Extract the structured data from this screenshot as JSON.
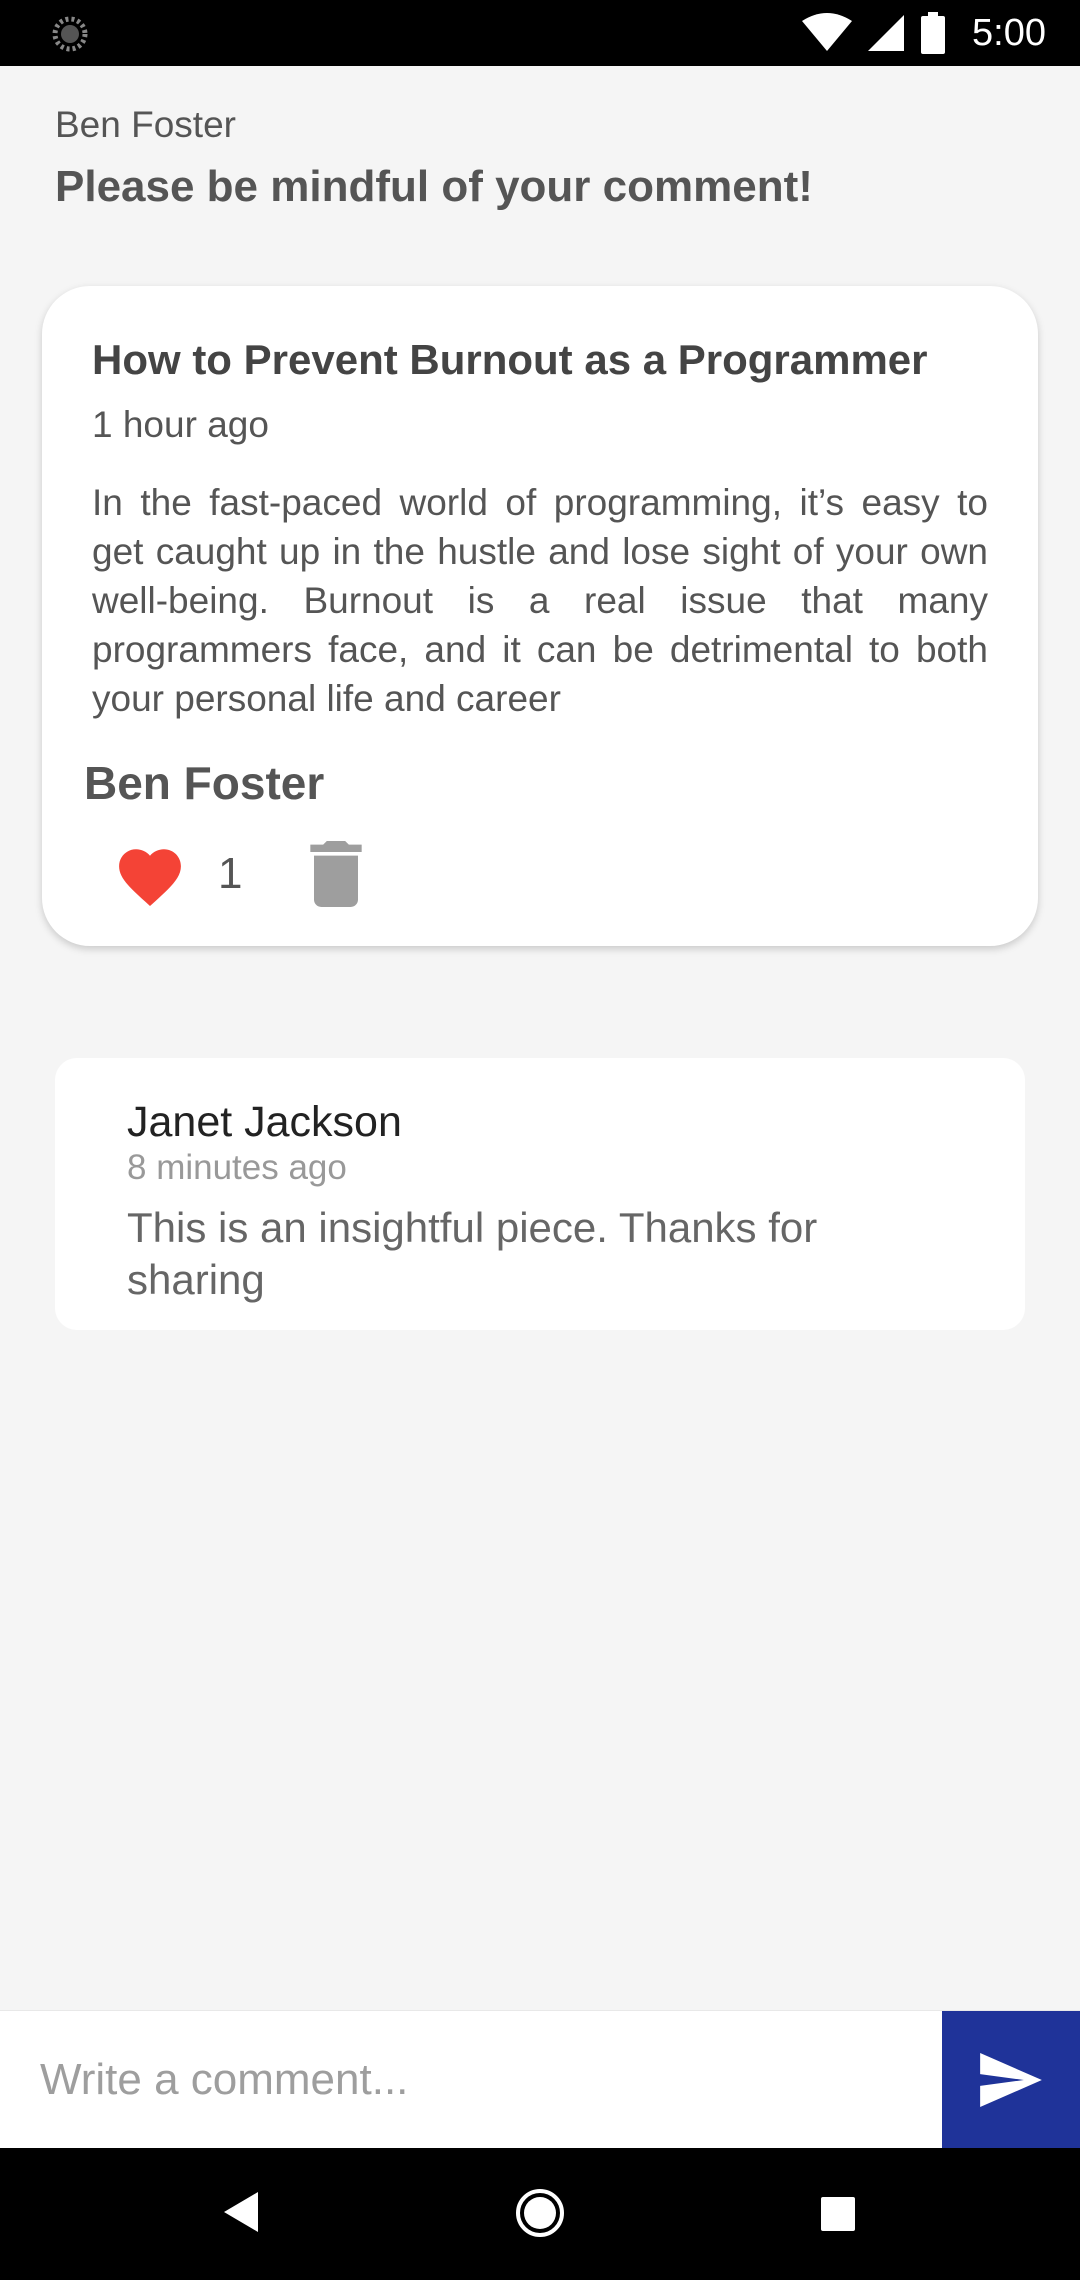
{
  "status_bar": {
    "time": "5:00",
    "icons": [
      "loading-spinner-icon",
      "wifi-icon",
      "cellular-signal-icon",
      "battery-icon"
    ]
  },
  "header": {
    "user_name": "Ben Foster",
    "notice": "Please be mindful of your comment!"
  },
  "post": {
    "title": "How to Prevent Burnout as a Programmer",
    "time_ago": "1 hour ago",
    "body": "In the fast-paced world of programming, it’s easy to get caught up in the hustle and lose sight of your own well-being. Burnout is a real issue that many programmers face, and it can be detrimental to both your personal life and career",
    "author": "Ben Foster",
    "like_count": "1",
    "like_icon": "heart-icon",
    "delete_icon": "trash-icon",
    "like_color": "#f44336"
  },
  "comments": [
    {
      "author": "Janet Jackson",
      "time_ago": "8 minutes ago",
      "text": "This is an insightful piece. Thanks for sharing"
    }
  ],
  "compose": {
    "placeholder": "Write a comment...",
    "value": "",
    "send_icon": "send-icon",
    "send_color": "#1f3399"
  },
  "nav_bar": {
    "icons": [
      "back-icon",
      "home-icon",
      "recents-icon"
    ]
  }
}
